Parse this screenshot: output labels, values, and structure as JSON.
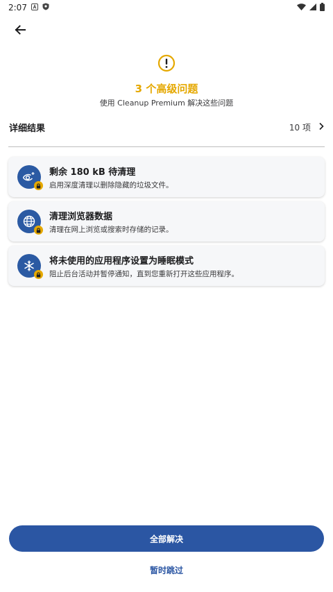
{
  "status_bar": {
    "time": "2:07",
    "icons": [
      "a-notification-icon",
      "shield-notification-icon",
      "wifi-icon",
      "signal-icon",
      "battery-icon"
    ]
  },
  "header": {
    "back_icon": "arrow-back-icon",
    "warning_icon": "exclamation-circle-icon",
    "headline": "3 个高级问题",
    "subline": "使用 Cleanup Premium 解决这些问题"
  },
  "details": {
    "title": "详细结果",
    "count": "10 项",
    "chevron_icon": "chevron-right-icon"
  },
  "cards": [
    {
      "icon": "eye-sparkle-icon",
      "title": "剩余 180 kB 待清理",
      "desc": "启用深度清理以删除隐藏的垃圾文件。"
    },
    {
      "icon": "globe-icon",
      "title": "清理浏览器数据",
      "desc": "清理在网上浏览或搜索时存储的记录。"
    },
    {
      "icon": "snowflake-icon",
      "title": "将未使用的应用程序设置为睡眠模式",
      "desc": "阻止后台活动并暂停通知，直到您重新打开这些应用程序。"
    }
  ],
  "actions": {
    "resolve_all": "全部解决",
    "skip": "暂时跳过"
  },
  "colors": {
    "accent_blue": "#2b56a3",
    "warning_yellow": "#e5a800"
  }
}
